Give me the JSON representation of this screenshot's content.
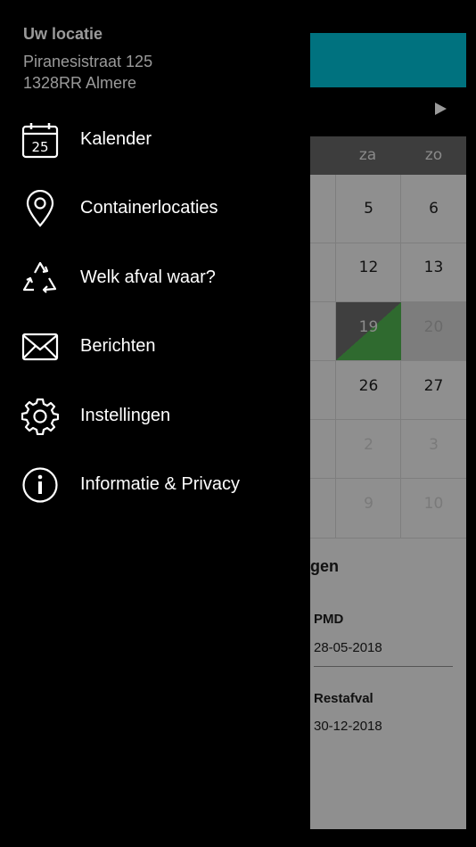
{
  "location": {
    "title": "Uw locatie",
    "street": "Piranesistraat 125",
    "city": "1328RR Almere"
  },
  "menu": [
    {
      "label": "Kalender",
      "icon": "calendar-icon",
      "icon_text": "25"
    },
    {
      "label": "Containerlocaties",
      "icon": "map-pin-icon"
    },
    {
      "label": "Welk afval waar?",
      "icon": "recycle-icon"
    },
    {
      "label": "Berichten",
      "icon": "envelope-icon"
    },
    {
      "label": "Instellingen",
      "icon": "gear-icon"
    },
    {
      "label": "Informatie & Privacy",
      "icon": "info-icon"
    }
  ],
  "background": {
    "day_names": [
      "za",
      "zo"
    ],
    "weeks": [
      [
        "5",
        "6"
      ],
      [
        "12",
        "13"
      ],
      [
        "19",
        "20"
      ],
      [
        "26",
        "27"
      ],
      [
        "2",
        "3"
      ],
      [
        "9",
        "10"
      ]
    ],
    "partial_marker": "5",
    "section_title": "gen",
    "upcoming": [
      {
        "type": "PMD",
        "date": "28-05-2018"
      },
      {
        "type": "Restafval",
        "date": "30-12-2018"
      }
    ],
    "colors": {
      "accent": "#00727f",
      "highlight": "#2f6a2f"
    }
  }
}
